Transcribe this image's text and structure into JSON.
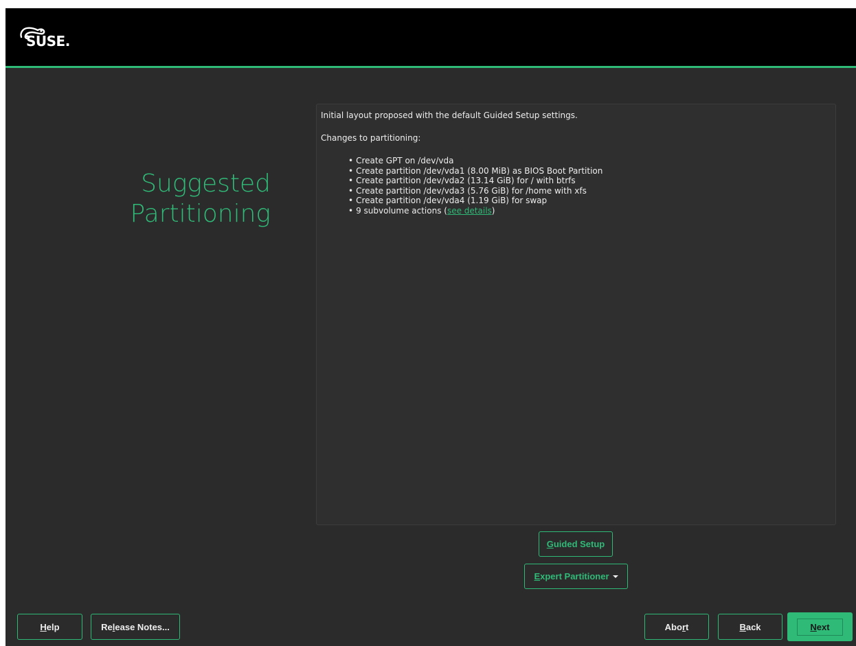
{
  "brand": {
    "logo_text": "SUSE.",
    "accent": "#30ba78",
    "topbar_bg": "#000000",
    "body_bg": "#2b2b2b"
  },
  "page": {
    "title_line1": "Suggested",
    "title_line2": "Partitioning"
  },
  "panel": {
    "intro": "Initial layout proposed with the default Guided Setup settings.",
    "changes_heading": "Changes to partitioning:",
    "bullet": "•",
    "items": [
      "Create GPT on /dev/vda",
      "Create partition /dev/vda1 (8.00 MiB) as BIOS Boot Partition",
      "Create partition /dev/vda2 (13.14 GiB) for / with btrfs",
      "Create partition /dev/vda3 (5.76 GiB) for /home with xfs",
      "Create partition /dev/vda4 (1.19 GiB) for swap"
    ],
    "subvolume_prefix": "9 subvolume actions (",
    "subvolume_link": "see details",
    "subvolume_suffix": ")"
  },
  "actions": {
    "guided_setup": {
      "mnemonic": "G",
      "rest": "uided Setup"
    },
    "expert_partitioner": {
      "mnemonic": "E",
      "rest": "xpert Partitioner"
    }
  },
  "footer": {
    "help": {
      "mnemonic": "H",
      "rest": "elp"
    },
    "release_notes": {
      "pre": "Re",
      "mnemonic": "l",
      "rest": "ease Notes..."
    },
    "abort": {
      "pre": "Abo",
      "mnemonic": "r",
      "rest": "t"
    },
    "back": {
      "mnemonic": "B",
      "rest": "ack"
    },
    "next": {
      "mnemonic": "N",
      "rest": "ext"
    }
  },
  "icons": {
    "logo": "suse-chameleon-icon",
    "dropdown": "caret-down-icon"
  }
}
